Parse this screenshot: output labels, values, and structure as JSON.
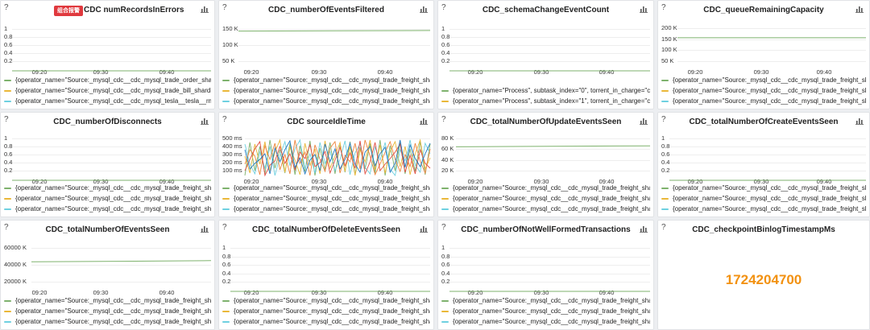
{
  "colors": {
    "series_green": "#7eb26d",
    "series_yellow": "#eab839",
    "series_cyan": "#6ed0e0",
    "series_orange": "#ef843c",
    "series_red": "#e24d42",
    "series_blue": "#1f78c1",
    "series_purple": "#ba43a9",
    "stat_orange": "#f29111",
    "alert_red": "#e0393e"
  },
  "panels": [
    {
      "title": "CDC numRecordsInErrors",
      "help": "?",
      "badge": "组合报警",
      "menu_icon": "bar-chart-icon",
      "y_ticks": [
        "1",
        "0.8",
        "0.6",
        "0.4",
        "0.2"
      ],
      "x_ticks": [
        "09:20",
        "09:30",
        "09:40"
      ],
      "legend": [
        {
          "color": "#7eb26d",
          "label": "{operator_name=\"Source:_mysql_cdc__cdc_mysql_trade_order_sharc"
        },
        {
          "color": "#eab839",
          "label": "{operator_name=\"Source:_mysql_cdc__cdc_mysql_trade_bill_shardin"
        },
        {
          "color": "#6ed0e0",
          "label": "{operator_name=\"Source:_mysql_cdc__cdc_mysql_tesla__tesla__rm_"
        }
      ]
    },
    {
      "title": "CDC_numberOfEventsFiltered",
      "help": "?",
      "menu_icon": "bar-chart-icon",
      "y_ticks": [
        "150 K",
        "100 K",
        "50 K"
      ],
      "x_ticks": [
        "09:20",
        "09:30",
        "09:40"
      ],
      "legend": [
        {
          "color": "#7eb26d",
          "label": "{operator_name=\"Source:_mysql_cdc__cdc_mysql_trade_freight_sha"
        },
        {
          "color": "#eab839",
          "label": "{operator_name=\"Source:_mysql_cdc__cdc_mysql_trade_freight_sha"
        },
        {
          "color": "#6ed0e0",
          "label": "{operator_name=\"Source:_mysql_cdc__cdc_mysql_trade_freight_sha"
        }
      ]
    },
    {
      "title": "CDC_schemaChangeEventCount",
      "help": "?",
      "menu_icon": "bar-chart-icon",
      "y_ticks": [
        "1",
        "0.8",
        "0.6",
        "0.4",
        "0.2"
      ],
      "x_ticks": [
        "09:20",
        "09:30",
        "09:40"
      ],
      "legend": [
        {
          "color": "#7eb26d",
          "label": "{operator_name=\"Process\", subtask_index=\"0\", torrent_in_charge=\"c"
        },
        {
          "color": "#eab839",
          "label": "{operator_name=\"Process\", subtask_index=\"1\", torrent_in_charge=\"ca"
        }
      ]
    },
    {
      "title": "CDC_queueRemainingCapacity",
      "help": "?",
      "menu_icon": "bar-chart-icon",
      "y_ticks": [
        "200 K",
        "150 K",
        "100 K",
        "50 K"
      ],
      "x_ticks": [
        "09:20",
        "09:30",
        "09:40"
      ],
      "legend": [
        {
          "color": "#7eb26d",
          "label": "{operator_name=\"Source:_mysql_cdc__cdc_mysql_trade_freight_sha"
        },
        {
          "color": "#eab839",
          "label": "{operator_name=\"Source:_mysql_cdc__cdc_mysql_trade_freight_sha"
        },
        {
          "color": "#6ed0e0",
          "label": "{operator_name=\"Source:_mysql_cdc__cdc_mysql_trade_freight_sha"
        }
      ]
    },
    {
      "title": "CDC_numberOfDisconnects",
      "help": "?",
      "menu_icon": "bar-chart-icon",
      "y_ticks": [
        "1",
        "0.8",
        "0.6",
        "0.4",
        "0.2"
      ],
      "x_ticks": [
        "09:20",
        "09:30",
        "09:40"
      ],
      "legend": [
        {
          "color": "#7eb26d",
          "label": "{operator_name=\"Source:_mysql_cdc__cdc_mysql_trade_freight_sha"
        },
        {
          "color": "#eab839",
          "label": "{operator_name=\"Source:_mysql_cdc__cdc_mysql_trade_freight_sha"
        },
        {
          "color": "#6ed0e0",
          "label": "{operator_name=\"Source:_mysql_cdc__cdc_mysql_trade_freight_sha"
        }
      ]
    },
    {
      "title": "CDC sourceIdleTime",
      "help": "?",
      "menu_icon": "bar-chart-icon",
      "y_ticks": [
        "500 ms",
        "400 ms",
        "300 ms",
        "200 ms",
        "100 ms"
      ],
      "x_ticks": [
        "09:20",
        "09:30",
        "09:40"
      ],
      "legend": [
        {
          "color": "#7eb26d",
          "label": "{operator_name=\"Source:_mysql_cdc__cdc_mysql_trade_freight_sha"
        },
        {
          "color": "#eab839",
          "label": "{operator_name=\"Source:_mysql_cdc__cdc_mysql_trade_freight_sha"
        },
        {
          "color": "#6ed0e0",
          "label": "{operator_name=\"Source:_mysql_cdc__cdc_mysql_trade_freight_sha"
        }
      ]
    },
    {
      "title": "CDC_totalNumberOfUpdateEventsSeen",
      "help": "?",
      "menu_icon": "bar-chart-icon",
      "y_ticks": [
        "80 K",
        "60 K",
        "40 K",
        "20 K"
      ],
      "x_ticks": [
        "09:20",
        "09:30",
        "09:40"
      ],
      "legend": [
        {
          "color": "#7eb26d",
          "label": "{operator_name=\"Source:_mysql_cdc__cdc_mysql_trade_freight_sha"
        },
        {
          "color": "#eab839",
          "label": "{operator_name=\"Source:_mysql_cdc__cdc_mysql_trade_freight_sha"
        },
        {
          "color": "#6ed0e0",
          "label": "{operator_name=\"Source:_mysql_cdc__cdc_mysql_trade_freight_sha"
        }
      ]
    },
    {
      "title": "CDC_totalNumberOfCreateEventsSeen",
      "help": "?",
      "menu_icon": "bar-chart-icon",
      "y_ticks": [
        "1",
        "0.8",
        "0.6",
        "0.4",
        "0.2"
      ],
      "x_ticks": [
        "09:20",
        "09:30",
        "09:40"
      ],
      "legend": [
        {
          "color": "#7eb26d",
          "label": "{operator_name=\"Source:_mysql_cdc__cdc_mysql_trade_freight_sha"
        },
        {
          "color": "#eab839",
          "label": "{operator_name=\"Source:_mysql_cdc__cdc_mysql_trade_freight_sha"
        },
        {
          "color": "#6ed0e0",
          "label": "{operator_name=\"Source:_mysql_cdc__cdc_mysql_trade_freight_sha"
        }
      ]
    },
    {
      "title": "CDC_totalNumberOfEventsSeen",
      "help": "?",
      "menu_icon": "bar-chart-icon",
      "y_ticks": [
        "60000 K",
        "40000 K",
        "20000 K"
      ],
      "x_ticks": [
        "09:20",
        "09:30",
        "09:40"
      ],
      "legend": [
        {
          "color": "#7eb26d",
          "label": "{operator_name=\"Source:_mysql_cdc__cdc_mysql_trade_freight_sha"
        },
        {
          "color": "#eab839",
          "label": "{operator_name=\"Source:_mysql_cdc__cdc_mysql_trade_freight_sha"
        },
        {
          "color": "#6ed0e0",
          "label": "{operator_name=\"Source:_mysql_cdc__cdc_mysql_trade_freight_sha"
        }
      ]
    },
    {
      "title": "CDC_totalNumberOfDeleteEventsSeen",
      "help": "?",
      "menu_icon": "bar-chart-icon",
      "y_ticks": [
        "1",
        "0.8",
        "0.6",
        "0.4",
        "0.2"
      ],
      "x_ticks": [
        "09:20",
        "09:30",
        "09:40"
      ],
      "legend": [
        {
          "color": "#7eb26d",
          "label": "{operator_name=\"Source:_mysql_cdc__cdc_mysql_trade_freight_sha"
        },
        {
          "color": "#eab839",
          "label": "{operator_name=\"Source:_mysql_cdc__cdc_mysql_trade_freight_sha"
        },
        {
          "color": "#6ed0e0",
          "label": "{operator_name=\"Source:_mysql_cdc__cdc_mysql_trade_freight_sha"
        }
      ]
    },
    {
      "title": "CDC_numberOfNotWellFormedTransactions",
      "help": "?",
      "menu_icon": "bar-chart-icon",
      "y_ticks": [
        "1",
        "0.8",
        "0.6",
        "0.4",
        "0.2"
      ],
      "x_ticks": [
        "09:20",
        "09:30",
        "09:40"
      ],
      "legend": [
        {
          "color": "#7eb26d",
          "label": "{operator_name=\"Source:_mysql_cdc__cdc_mysql_trade_freight_sha"
        },
        {
          "color": "#eab839",
          "label": "{operator_name=\"Source:_mysql_cdc__cdc_mysql_trade_freight_sha"
        },
        {
          "color": "#6ed0e0",
          "label": "{operator_name=\"Source:_mysql_cdc__cdc_mysql_trade_freight_sha"
        }
      ]
    },
    {
      "title": "CDC_checkpointBinlogTimestampMs",
      "help": "?",
      "stat_value": "1724204700"
    }
  ],
  "chart_data": [
    {
      "panel": "CDC numRecordsInErrors",
      "type": "line",
      "ylim": [
        0,
        1
      ],
      "x": [
        "09:20",
        "09:30",
        "09:40"
      ],
      "series": [
        {
          "values": [
            0,
            0,
            0
          ]
        }
      ]
    },
    {
      "panel": "CDC_numberOfEventsFiltered",
      "type": "line",
      "ylim": [
        0,
        160000
      ],
      "x": [
        "09:20",
        "09:30",
        "09:40"
      ],
      "series": [
        {
          "values": [
            152000,
            153000,
            154000
          ]
        }
      ]
    },
    {
      "panel": "CDC_schemaChangeEventCount",
      "type": "line",
      "ylim": [
        0,
        1
      ],
      "x": [
        "09:20",
        "09:30",
        "09:40"
      ],
      "series": [
        {
          "values": [
            0,
            0,
            0
          ]
        }
      ]
    },
    {
      "panel": "CDC_queueRemainingCapacity",
      "type": "line",
      "ylim": [
        0,
        210000
      ],
      "x": [
        "09:20",
        "09:30",
        "09:40"
      ],
      "series": [
        {
          "values": [
            163000,
            163000,
            163000
          ]
        }
      ]
    },
    {
      "panel": "CDC_numberOfDisconnects",
      "type": "line",
      "ylim": [
        0,
        1
      ],
      "x": [
        "09:20",
        "09:30",
        "09:40"
      ],
      "series": [
        {
          "values": [
            0,
            0,
            0
          ]
        }
      ]
    },
    {
      "panel": "CDC sourceIdleTime",
      "type": "line",
      "ylim": [
        0,
        520
      ],
      "x": [
        "09:20",
        "09:30",
        "09:40"
      ],
      "unit": "ms",
      "series": [
        {
          "values": [
            60,
            470,
            120,
            420,
            80,
            500,
            150,
            380,
            90,
            460,
            70,
            430,
            110,
            490,
            60,
            400,
            130,
            470,
            80,
            440,
            100,
            480,
            70,
            410,
            140,
            460,
            90,
            500,
            60,
            430,
            120,
            470,
            80,
            390,
            110,
            480,
            70,
            450
          ]
        },
        {
          "values": [
            300,
            90,
            450,
            200,
            480,
            120,
            350,
            500,
            100,
            410,
            250,
            70,
            460,
            180,
            390,
            80,
            490,
            150,
            300,
            470,
            110,
            420,
            60,
            380,
            230,
            500,
            130,
            440,
            90,
            360,
            480,
            170,
            420,
            70,
            330,
            500,
            140,
            280
          ]
        },
        {
          "values": [
            450,
            200,
            80,
            350,
            150,
            420,
            60,
            300,
            480,
            180,
            390,
            500,
            140,
            330,
            90,
            470,
            210,
            360,
            120,
            260,
            490,
            70,
            340,
            450,
            160,
            80,
            410,
            250,
            470,
            140,
            60,
            380,
            240,
            500,
            190,
            100,
            460,
            330
          ]
        },
        {
          "values": [
            200,
            380,
            300,
            70,
            430,
            260,
            460,
            130,
            320,
            80,
            500,
            210,
            350,
            60,
            440,
            260,
            110,
            400,
            480,
            90,
            310,
            230,
            460,
            140,
            500,
            300,
            70,
            200,
            350,
            480,
            260,
            110,
            320,
            170,
            460,
            240,
            90,
            390
          ]
        },
        {
          "values": [
            120,
            260,
            390,
            480,
            60,
            190,
            240,
            420,
            210,
            330,
            130,
            350,
            270,
            440,
            170,
            220,
            360,
            90,
            250,
            410,
            180,
            340,
            150,
            490,
            80,
            230,
            470,
            120,
            200,
            270,
            350,
            450,
            100,
            310,
            80,
            380,
            210,
            150
          ]
        },
        {
          "values": [
            380,
            140,
            210,
            260,
            330,
            80,
            400,
            230,
            380,
            490,
            160,
            280,
            80,
            250,
            320,
            120,
            450,
            230,
            390,
            140,
            260,
            460,
            200,
            100,
            350,
            420,
            180,
            330,
            410,
            100,
            210,
            500,
            160,
            440,
            270,
            170,
            330,
            460
          ]
        }
      ]
    },
    {
      "panel": "CDC_totalNumberOfUpdateEventsSeen",
      "type": "line",
      "ylim": [
        0,
        90000
      ],
      "x": [
        "09:20",
        "09:30",
        "09:40"
      ],
      "series": [
        {
          "values": [
            72000,
            73000,
            74000
          ]
        }
      ]
    },
    {
      "panel": "CDC_totalNumberOfCreateEventsSeen",
      "type": "line",
      "ylim": [
        0,
        1
      ],
      "x": [
        "09:20",
        "09:30",
        "09:40"
      ],
      "series": [
        {
          "values": [
            0,
            0,
            0
          ]
        }
      ]
    },
    {
      "panel": "CDC_totalNumberOfEventsSeen",
      "type": "line",
      "ylim": [
        0,
        75000000
      ],
      "x": [
        "09:20",
        "09:30",
        "09:40"
      ],
      "series": [
        {
          "values": [
            51000000,
            52000000,
            53000000
          ]
        }
      ]
    },
    {
      "panel": "CDC_totalNumberOfDeleteEventsSeen",
      "type": "line",
      "ylim": [
        0,
        1
      ],
      "x": [
        "09:20",
        "09:30",
        "09:40"
      ],
      "series": [
        {
          "values": [
            0,
            0,
            0
          ]
        }
      ]
    },
    {
      "panel": "CDC_numberOfNotWellFormedTransactions",
      "type": "line",
      "ylim": [
        0,
        1
      ],
      "x": [
        "09:20",
        "09:30",
        "09:40"
      ],
      "series": [
        {
          "values": [
            0,
            0,
            0
          ]
        }
      ]
    }
  ]
}
